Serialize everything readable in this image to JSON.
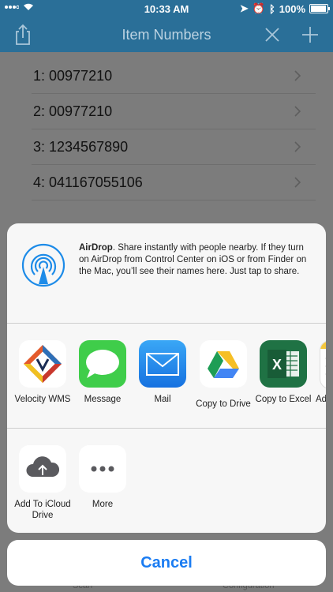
{
  "status_bar": {
    "time": "10:33 AM",
    "battery": "100%"
  },
  "nav": {
    "title": "Item Numbers"
  },
  "list": {
    "items": [
      {
        "label": "1:  00977210"
      },
      {
        "label": "2:  00977210"
      },
      {
        "label": "3:  1234567890"
      },
      {
        "label": "4:  041167055106"
      }
    ]
  },
  "share_sheet": {
    "airdrop": {
      "title": "AirDrop",
      "description": ". Share instantly with people nearby. If they turn on AirDrop from Control Center on iOS or from Finder on the Mac, you’ll see their names here. Just tap to share."
    },
    "apps": [
      {
        "label": "Velocity WMS",
        "icon": "velocity-wms-icon"
      },
      {
        "label": "Message",
        "icon": "message-bubble-icon"
      },
      {
        "label": "Mail",
        "icon": "envelope-icon"
      },
      {
        "label": "Copy to Drive",
        "icon": "google-drive-icon"
      },
      {
        "label": "Copy to Excel",
        "icon": "excel-icon"
      },
      {
        "label": "Ad",
        "icon": "notes-icon"
      }
    ],
    "actions": [
      {
        "label": "Add To iCloud Drive",
        "icon": "icloud-upload-icon"
      },
      {
        "label": "More",
        "icon": "more-dots-icon"
      }
    ],
    "cancel": "Cancel"
  },
  "tabs": {
    "left": "Scan",
    "right": "Configuration"
  }
}
